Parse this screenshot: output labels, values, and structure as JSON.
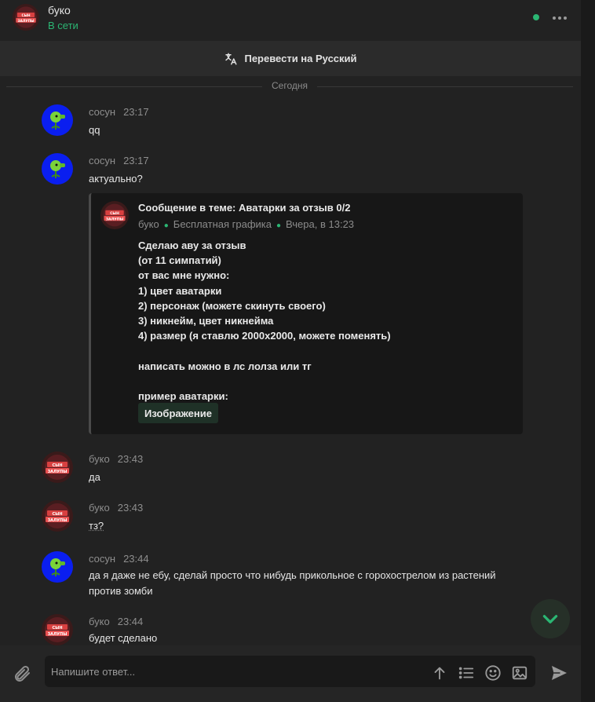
{
  "header": {
    "name": "буко",
    "status": "В сети",
    "avatar_text": "СЫН ЗАЛУПЫ"
  },
  "translate_label": "Перевести на Русский",
  "day_separator": "Сегодня",
  "messages": [
    {
      "author": "сосун",
      "time": "23:17",
      "text": "qq"
    },
    {
      "author": "сосун",
      "time": "23:17",
      "text": "актуально?"
    },
    {
      "author": "буко",
      "time": "23:43",
      "text": "да"
    },
    {
      "author": "буко",
      "time": "23:43",
      "text": "тз?"
    },
    {
      "author": "сосун",
      "time": "23:44",
      "text": "да я даже не ебу, сделай просто что нибудь прикольное с горохострелом из растений против зомби"
    },
    {
      "author": "буко",
      "time": "23:44",
      "text": "будет сделано"
    }
  ],
  "quote": {
    "title": "Сообщение в теме: Аватарки за отзыв 0/2",
    "author": "буко",
    "forum": "Бесплатная графика",
    "date": "Вчера, в 13:23",
    "body": [
      "Сделаю аву за отзыв",
      "(от 11 симпатий)",
      "от вас мне нужно:",
      "1) цвет аватарки",
      "2) персонаж (можете скинуть своего)",
      "3) никнейм, цвет никнейма",
      "4) размер (я ставлю 2000x2000, можете поменять)",
      "",
      "написать можно в лс лолза или тг",
      "",
      "пример аватарки:"
    ],
    "image_label": "Изображение"
  },
  "composer": {
    "placeholder": "Напишите ответ..."
  },
  "colors": {
    "online": "#2bb673",
    "accent_chip": "#1f3127",
    "sosun_avatar": "#0a1ef0"
  }
}
